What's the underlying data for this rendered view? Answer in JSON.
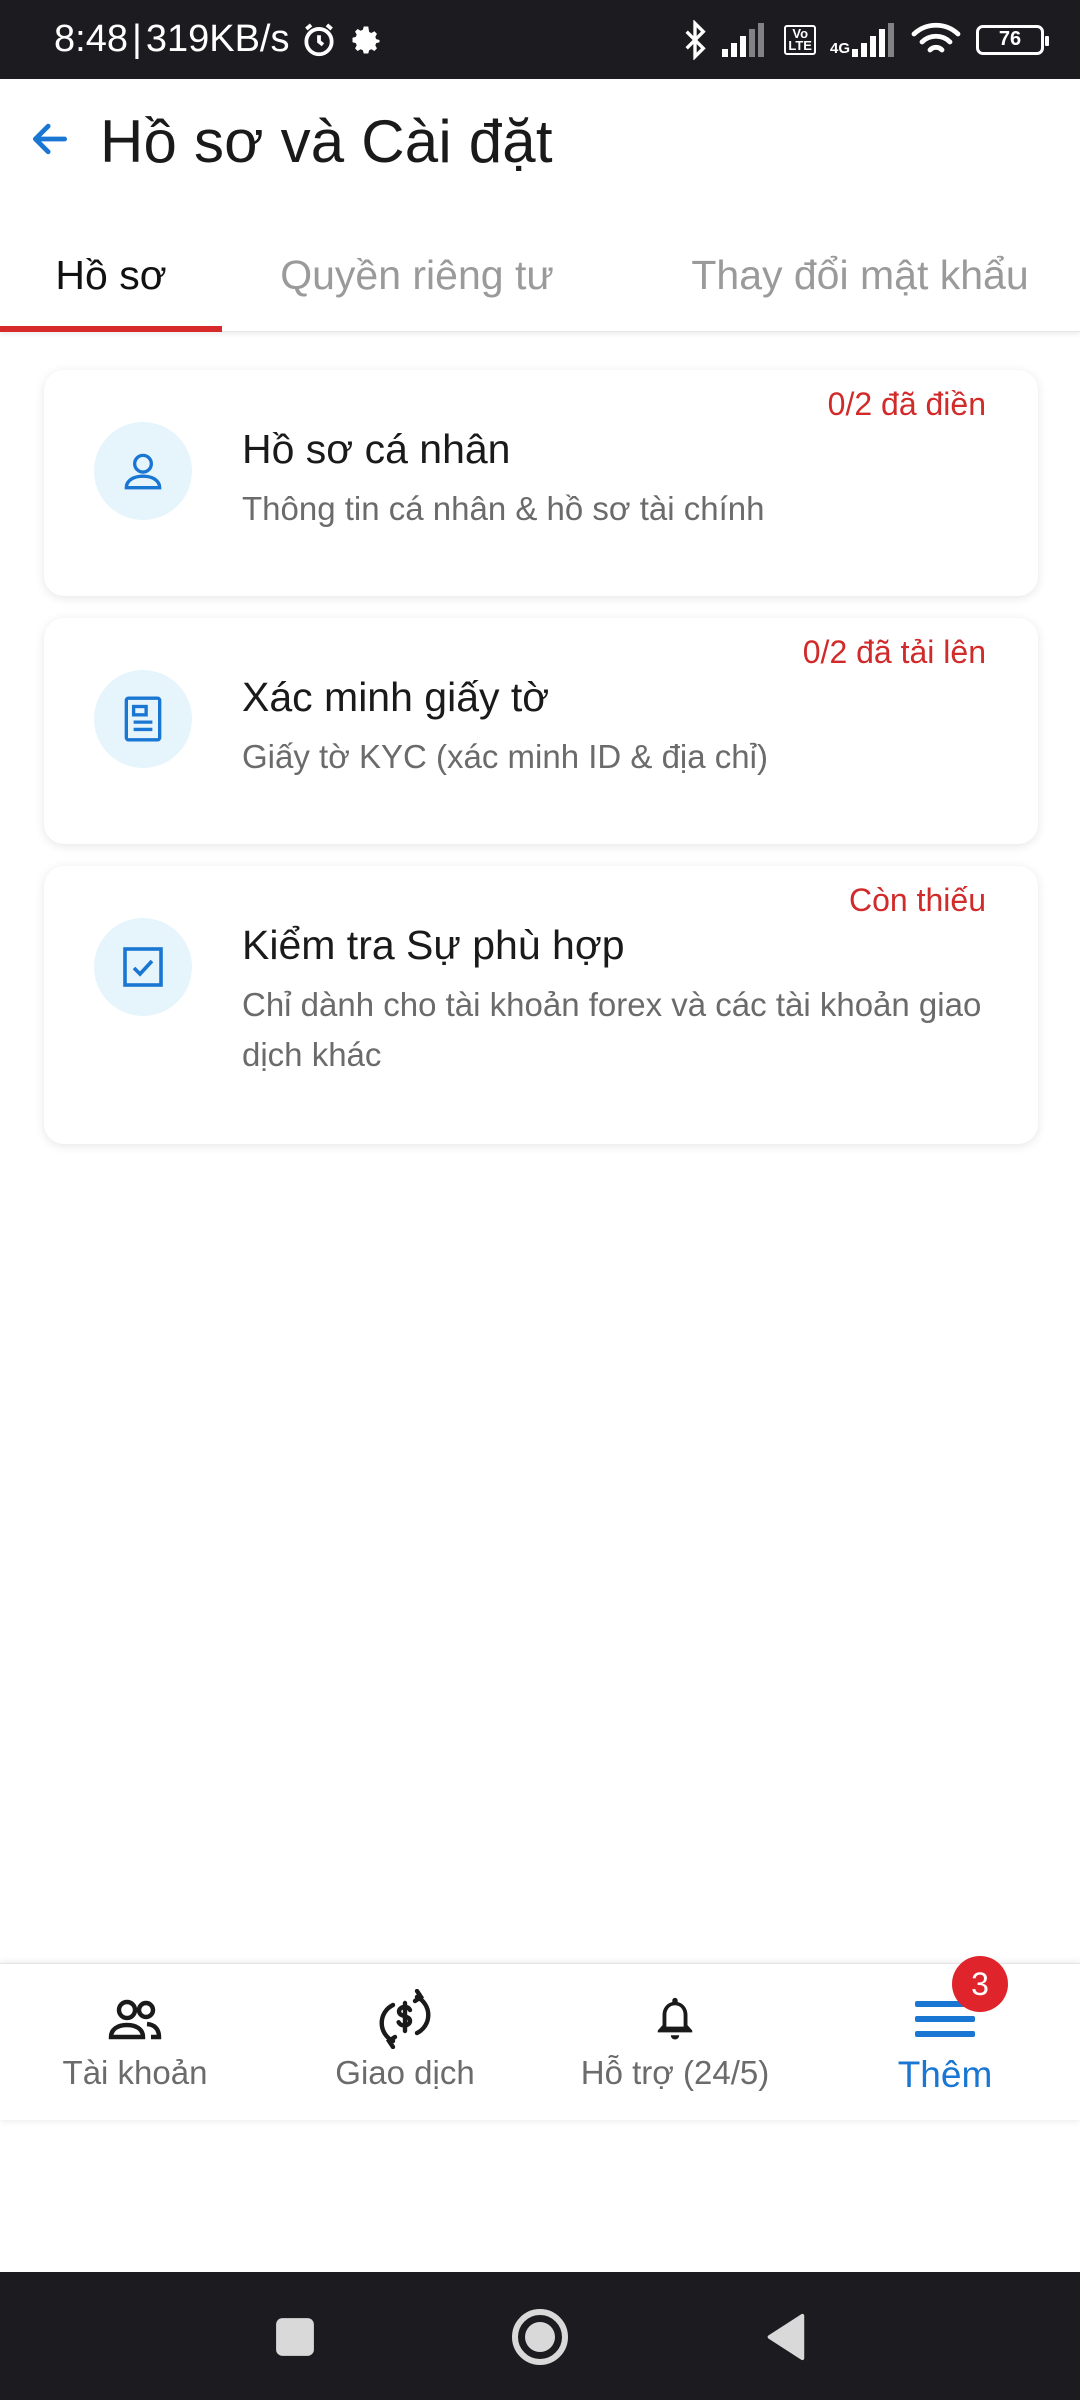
{
  "status_bar": {
    "time": "8:48",
    "separator": "|",
    "network_speed": "319KB/s",
    "battery": "76",
    "volte_label": "Vo\nLTE",
    "network_type": "4G",
    "icons": [
      "alarm-icon",
      "settings-icon",
      "bluetooth-icon",
      "signal-icon",
      "volte-icon",
      "signal-4g-icon",
      "wifi-icon",
      "battery-icon"
    ]
  },
  "header": {
    "title": "Hồ sơ và Cài đặt",
    "back_icon": "arrow-left-icon"
  },
  "tabs": [
    {
      "label": "Hồ sơ",
      "active": true
    },
    {
      "label": "Quyền riêng tư",
      "active": false
    },
    {
      "label": "Thay đổi mật khẩu",
      "active": false
    }
  ],
  "cards": [
    {
      "title": "Hồ sơ cá nhân",
      "subtitle": "Thông tin cá nhân & hồ sơ tài chính",
      "status": "0/2 đã điền",
      "icon": "user-icon"
    },
    {
      "title": "Xác minh giấy tờ",
      "subtitle": "Giấy tờ KYC (xác minh ID & địa chỉ)",
      "status": "0/2 đã tải lên",
      "icon": "document-icon"
    },
    {
      "title": "Kiểm tra Sự phù hợp",
      "subtitle": "Chỉ dành cho tài khoản forex và các tài khoản giao dịch khác",
      "status": "Còn thiếu",
      "icon": "checkbox-icon"
    }
  ],
  "bottom_nav": [
    {
      "label": "Tài khoản",
      "icon": "users-icon",
      "active": false
    },
    {
      "label": "Giao dịch",
      "icon": "dollar-exchange-icon",
      "active": false
    },
    {
      "label": "Hỗ trợ (24/5)",
      "icon": "bell-icon",
      "active": false
    },
    {
      "label": "Thêm",
      "icon": "menu-icon",
      "active": true,
      "badge": "3"
    }
  ],
  "colors": {
    "accent": "#1976d2",
    "alert": "#d12a2a",
    "tab_indicator": "#d72a2a",
    "icon_bg": "#e6f4fc",
    "status_bar_bg": "#1c1c20"
  }
}
